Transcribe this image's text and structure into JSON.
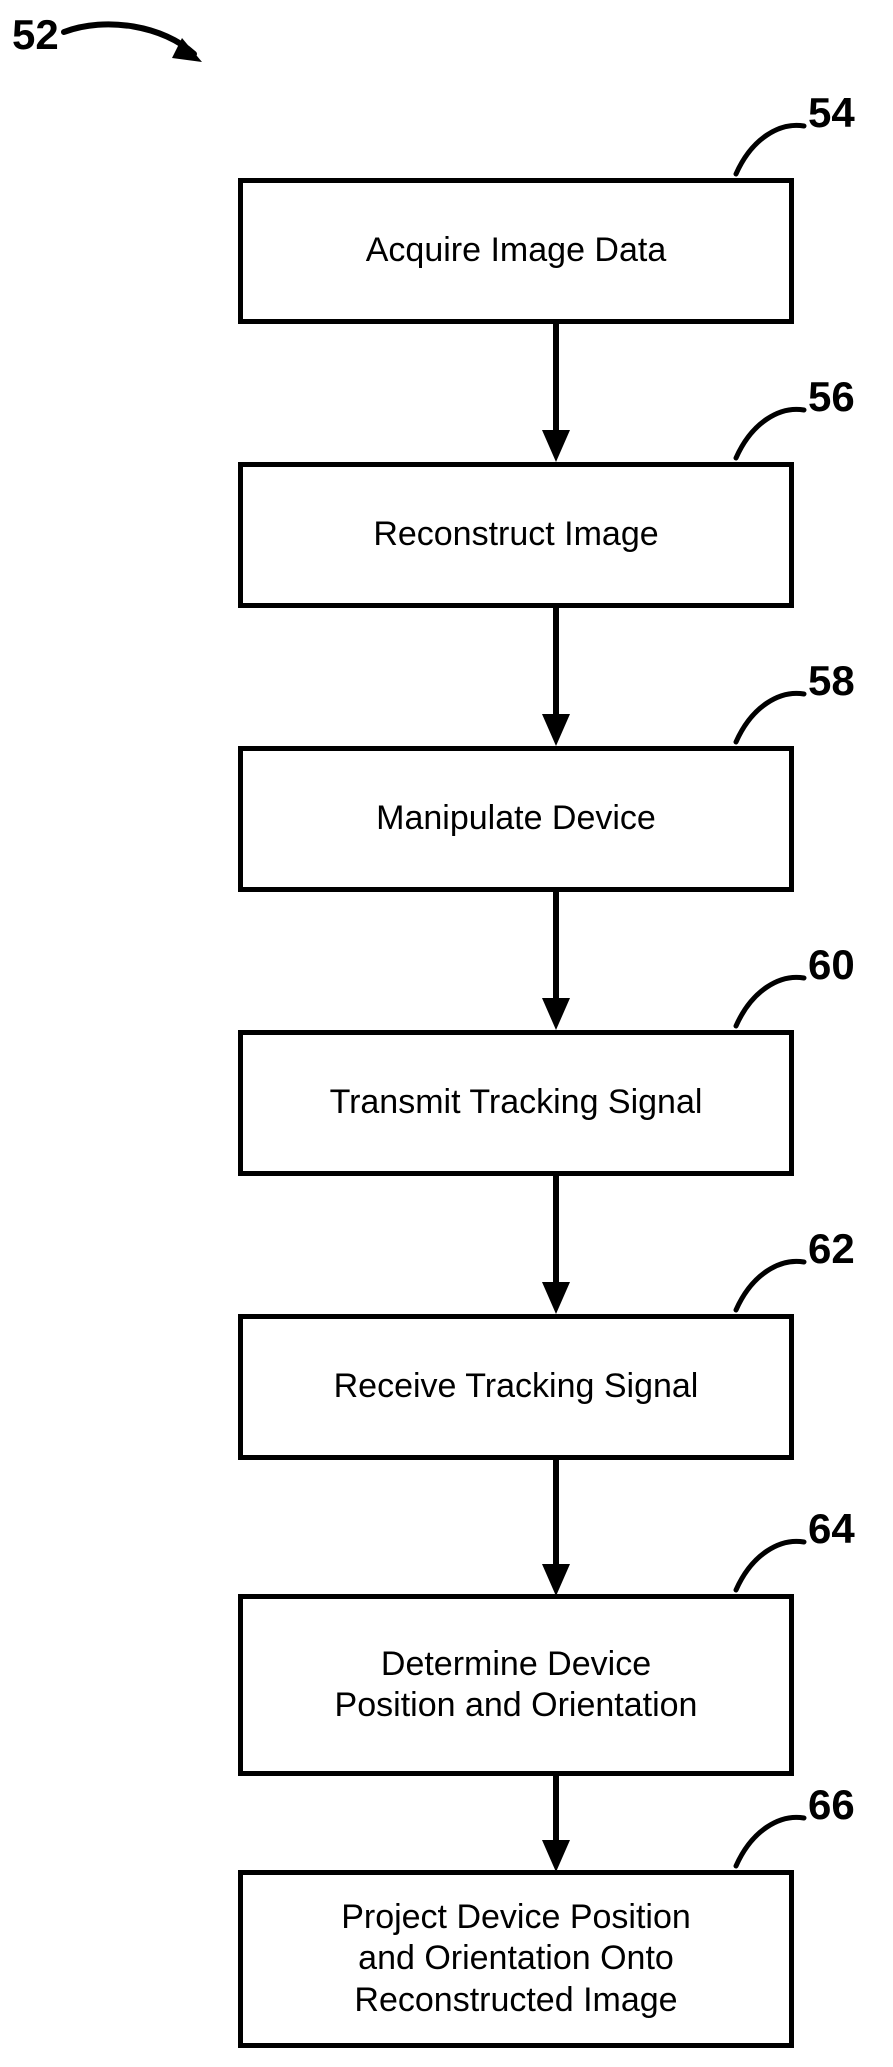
{
  "figure": {
    "number": "52",
    "title_hint": "Flowchart of device tracking and projection method",
    "stroke_color": "#000000",
    "background_color": "#ffffff"
  },
  "steps": [
    {
      "ref": "54",
      "label": "Acquire Image Data",
      "lines": [
        "Acquire Image Data"
      ]
    },
    {
      "ref": "56",
      "label": "Reconstruct Image",
      "lines": [
        "Reconstruct Image"
      ]
    },
    {
      "ref": "58",
      "label": "Manipulate Device",
      "lines": [
        "Manipulate Device"
      ]
    },
    {
      "ref": "60",
      "label": "Transmit Tracking Signal",
      "lines": [
        "Transmit Tracking Signal"
      ]
    },
    {
      "ref": "62",
      "label": "Receive Tracking Signal",
      "lines": [
        "Receive Tracking Signal"
      ]
    },
    {
      "ref": "64",
      "label": "Determine Device\nPosition and Orientation",
      "lines": [
        "Determine Device",
        "Position and Orientation"
      ]
    },
    {
      "ref": "66",
      "label": "Project Device Position\nand Orientation Onto\nReconstructed Image",
      "lines": [
        "Project Device Position",
        "and Orientation Onto",
        "Reconstructed Image"
      ]
    }
  ],
  "connectors": [
    {
      "from": "54",
      "to": "56"
    },
    {
      "from": "56",
      "to": "58"
    },
    {
      "from": "58",
      "to": "60"
    },
    {
      "from": "60",
      "to": "62"
    },
    {
      "from": "62",
      "to": "64"
    },
    {
      "from": "64",
      "to": "66"
    }
  ]
}
